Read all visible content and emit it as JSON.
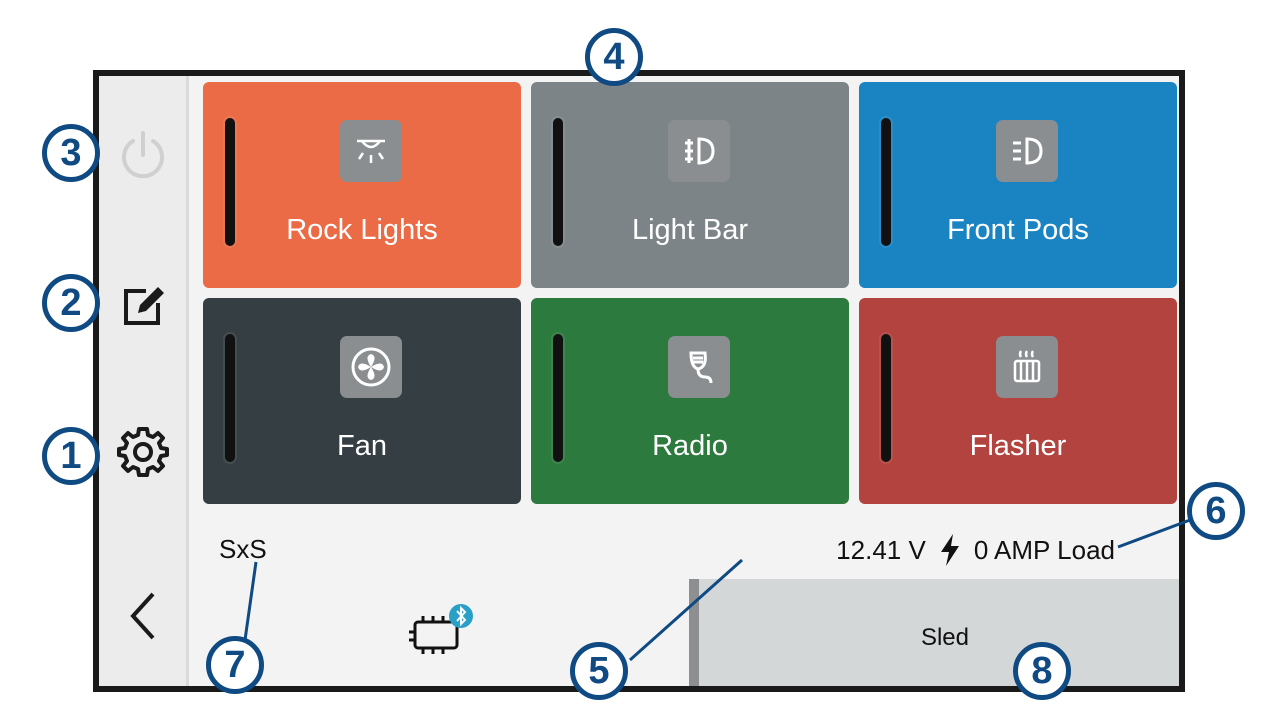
{
  "tiles": [
    {
      "label": "Rock Lights",
      "color": "#ea6b45",
      "icon": "rock-lights-icon"
    },
    {
      "label": "Light Bar",
      "color": "#7d8487",
      "icon": "light-bar-icon"
    },
    {
      "label": "Front Pods",
      "color": "#1a84c3",
      "icon": "front-pods-icon"
    },
    {
      "label": "Fan",
      "color": "#353e42",
      "icon": "fan-icon"
    },
    {
      "label": "Radio",
      "color": "#2d7a3f",
      "icon": "radio-icon"
    },
    {
      "label": "Flasher",
      "color": "#b3433e",
      "icon": "flasher-icon"
    }
  ],
  "status": {
    "name": "SxS",
    "voltage": "12.41 V",
    "load": "0 AMP Load"
  },
  "profile_button": "Sled",
  "callouts": [
    "1",
    "2",
    "3",
    "4",
    "5",
    "6",
    "7",
    "8"
  ],
  "colors": {
    "callout": "#0f4a83",
    "power_disabled": "#d0d0d0"
  }
}
